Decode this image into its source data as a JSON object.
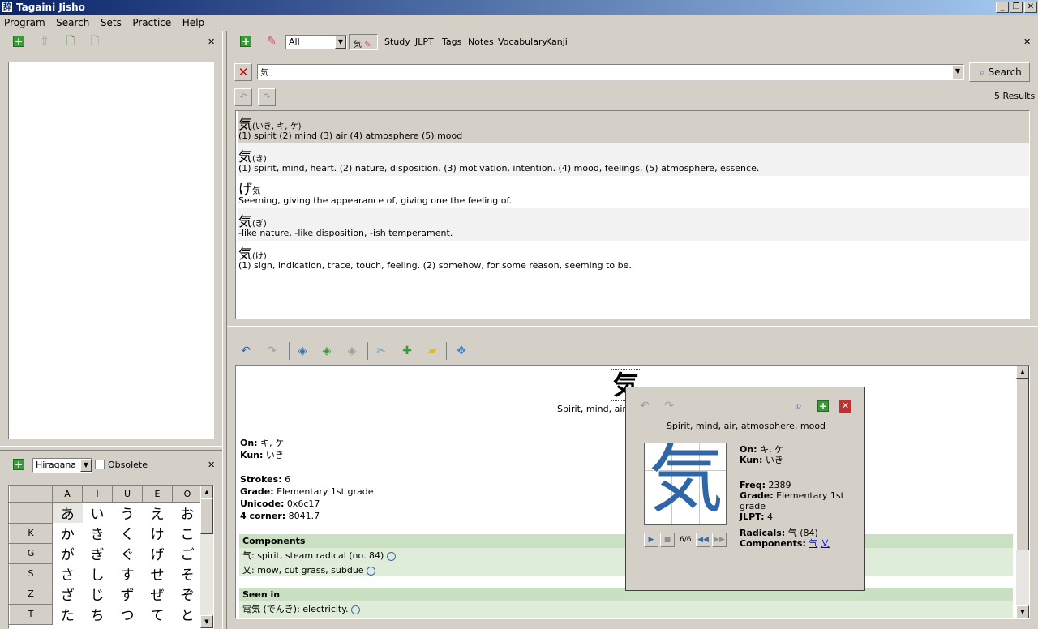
{
  "window": {
    "title": "Tagaini Jisho",
    "app_icon": "辞"
  },
  "menu": [
    "Program",
    "Search",
    "Sets",
    "Practice",
    "Help"
  ],
  "left_panel": {
    "kana": {
      "mode": "Hiragana",
      "obsolete_label": "Obsolete",
      "columns": [
        "A",
        "I",
        "U",
        "E",
        "O"
      ],
      "rows": [
        {
          "label": "",
          "cells": [
            "あ",
            "い",
            "う",
            "え",
            "お"
          ]
        },
        {
          "label": "K",
          "cells": [
            "か",
            "き",
            "く",
            "け",
            "こ"
          ]
        },
        {
          "label": "G",
          "cells": [
            "が",
            "ぎ",
            "ぐ",
            "げ",
            "ご"
          ]
        },
        {
          "label": "S",
          "cells": [
            "さ",
            "し",
            "す",
            "せ",
            "そ"
          ]
        },
        {
          "label": "Z",
          "cells": [
            "ざ",
            "じ",
            "ず",
            "ぜ",
            "ぞ"
          ]
        },
        {
          "label": "T",
          "cells": [
            "た",
            "ち",
            "つ",
            "て",
            "と"
          ]
        }
      ]
    }
  },
  "search_panel": {
    "filter_value": "All",
    "active_filter_tag": "気",
    "filter_tabs": [
      "Study",
      "JLPT",
      "Tags",
      "Notes",
      "Vocabulary",
      "Kanji"
    ],
    "query": "気",
    "search_button": "Search",
    "results_count": "5 Results",
    "results": [
      {
        "word": "気",
        "reading": "(いき, キ, ケ)",
        "meaning": "(1) spirit (2) mind (3) air (4) atmosphere (5) mood"
      },
      {
        "word": "気",
        "reading": "(き)",
        "meaning": "(1) spirit, mind, heart. (2) nature, disposition. (3) motivation, intention. (4) mood, feelings. (5) atmosphere, essence."
      },
      {
        "word": "げ",
        "reading": "気",
        "meaning": "Seeming, giving the appearance of, giving one the feeling of."
      },
      {
        "word": "気",
        "reading": "(ぎ)",
        "meaning": "-like nature, -like disposition, -ish temperament."
      },
      {
        "word": "気",
        "reading": "(け)",
        "meaning": "(1) sign, indication, trace, touch, feeling. (2) somehow, for some reason, seeming to be."
      }
    ]
  },
  "detail": {
    "kanji": "気",
    "meaning_partial": "Spirit, mind, air, a",
    "on_label": "On:",
    "on": "キ, ケ",
    "kun_label": "Kun:",
    "kun": "いき",
    "strokes_label": "Strokes:",
    "strokes": "6",
    "grade_label": "Grade:",
    "grade": "Elementary 1st grade",
    "unicode_label": "Unicode:",
    "unicode": "0x6c17",
    "corner_label": "4 corner:",
    "corner": "8041.7",
    "components_head": "Components",
    "components": [
      "气: spirit, steam radical (no. 84)",
      "乂: mow, cut grass, subdue"
    ],
    "seen_in_head": "Seen in",
    "seen_in": [
      "電気 (でんき): electricity."
    ]
  },
  "popup": {
    "meaning": "Spirit, mind, air, atmosphere, mood",
    "kanji": "気",
    "on_label": "On:",
    "on": "キ, ケ",
    "kun_label": "Kun:",
    "kun": "いき",
    "freq_label": "Freq:",
    "freq": "2389",
    "grade_label": "Grade:",
    "grade": "Elementary 1st grade",
    "jlpt_label": "JLPT:",
    "jlpt": "4",
    "radicals_label": "Radicals:",
    "radicals": "气 (84)",
    "components_label": "Components:",
    "component_1": "气",
    "component_2": "乂",
    "stroke_counter": "6/6"
  }
}
